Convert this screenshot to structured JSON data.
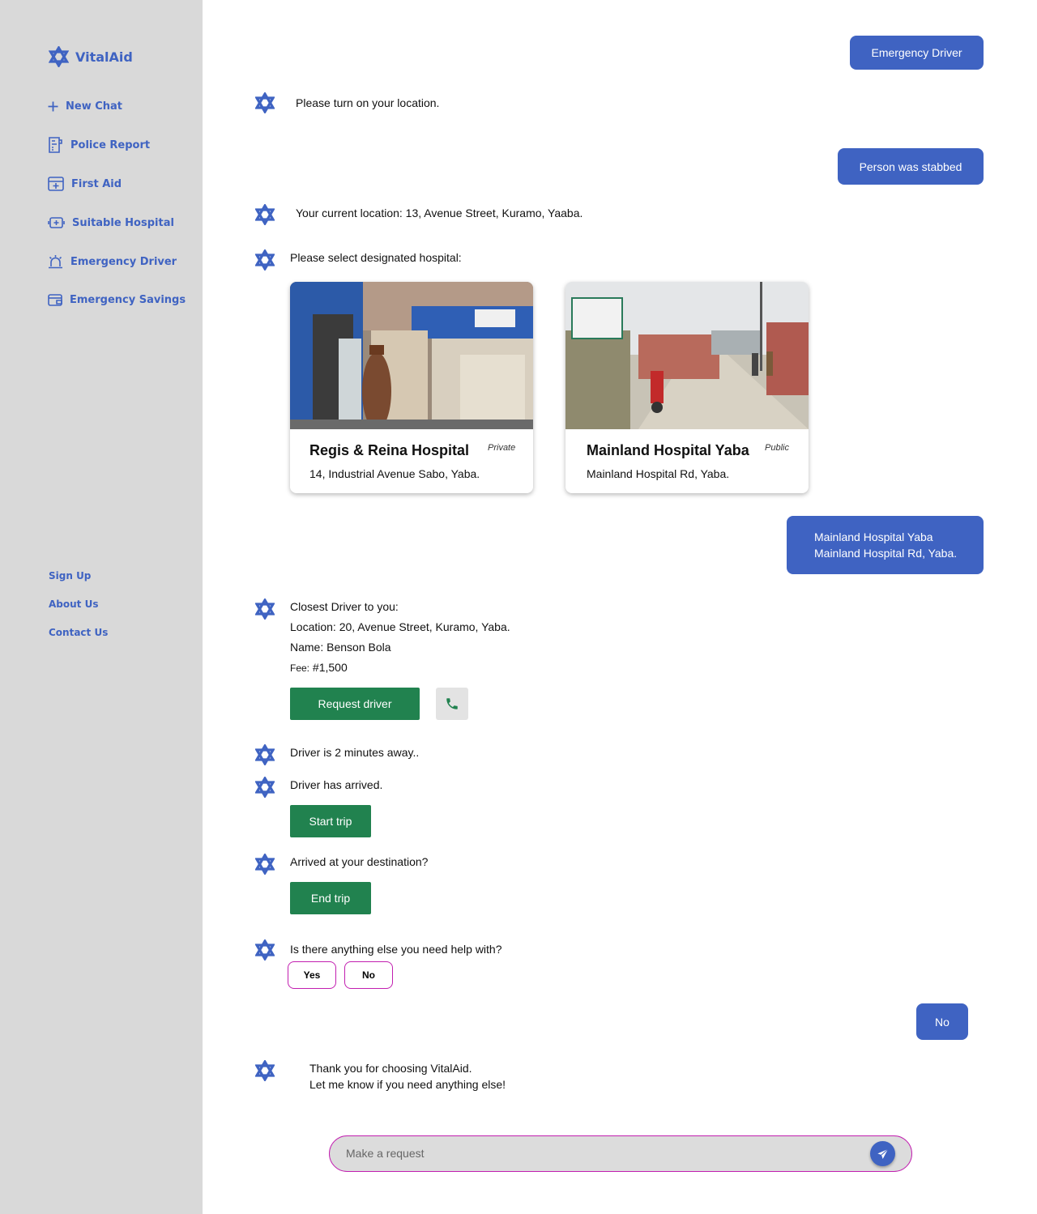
{
  "brand": {
    "name": "VitalAid",
    "logo_icon": "star-of-life-icon"
  },
  "sidebar": {
    "items": [
      {
        "label": "New Chat",
        "icon": "plus-icon"
      },
      {
        "label": "Police Report",
        "icon": "report-icon"
      },
      {
        "label": "First Aid",
        "icon": "first-aid-kit-icon"
      },
      {
        "label": "Suitable Hospital",
        "icon": "hospital-icon"
      },
      {
        "label": "Emergency Driver",
        "icon": "siren-icon"
      },
      {
        "label": "Emergency Savings",
        "icon": "wallet-icon"
      }
    ],
    "footer_links": [
      "Sign Up",
      "About Us",
      "Contact Us"
    ]
  },
  "colors": {
    "sidebar_bg": "#d9d9d9",
    "accent": "#3f63c2",
    "action_green": "#21824f",
    "choice_border": "#c21fb0"
  },
  "chat": {
    "user_1": "Emergency Driver",
    "bot_1": "Please turn on your location.",
    "user_2": "Person was stabbed",
    "bot_2": "Your current location: 13, Avenue Street, Kuramo, Yaaba.",
    "bot_3": "Please select designated hospital:",
    "hospitals": [
      {
        "name": "Regis & Reina Hospital",
        "type": "Private",
        "address": "14, Industrial Avenue Sabo, Yaba."
      },
      {
        "name": "Mainland Hospital Yaba",
        "type": "Public",
        "address": "Mainland Hospital Rd, Yaba."
      }
    ],
    "user_3": {
      "line1": "Mainland Hospital Yaba",
      "line2": "Mainland Hospital Rd, Yaba."
    },
    "driver": {
      "heading": "Closest Driver to you:",
      "location": "Location: 20, Avenue Street, Kuramo, Yaba.",
      "name": "Name: Benson Bola",
      "fee_label": "Fee:",
      "fee_value": "#1,500",
      "request_label": "Request driver",
      "call_icon": "phone-icon"
    },
    "bot_eta": "Driver is 2 minutes away..",
    "bot_arrived": "Driver has arrived.",
    "start_trip": "Start trip",
    "bot_destination": "Arrived at your destination?",
    "end_trip": "End trip",
    "bot_help": "Is there anything else you need help with?",
    "choices": {
      "yes": "Yes",
      "no": "No"
    },
    "user_4": "No",
    "bot_final": {
      "line1": "Thank you for choosing VitalAid.",
      "line2": "Let me know if you need anything else!"
    }
  },
  "input": {
    "placeholder": "Make a request",
    "send_icon": "send-icon"
  }
}
